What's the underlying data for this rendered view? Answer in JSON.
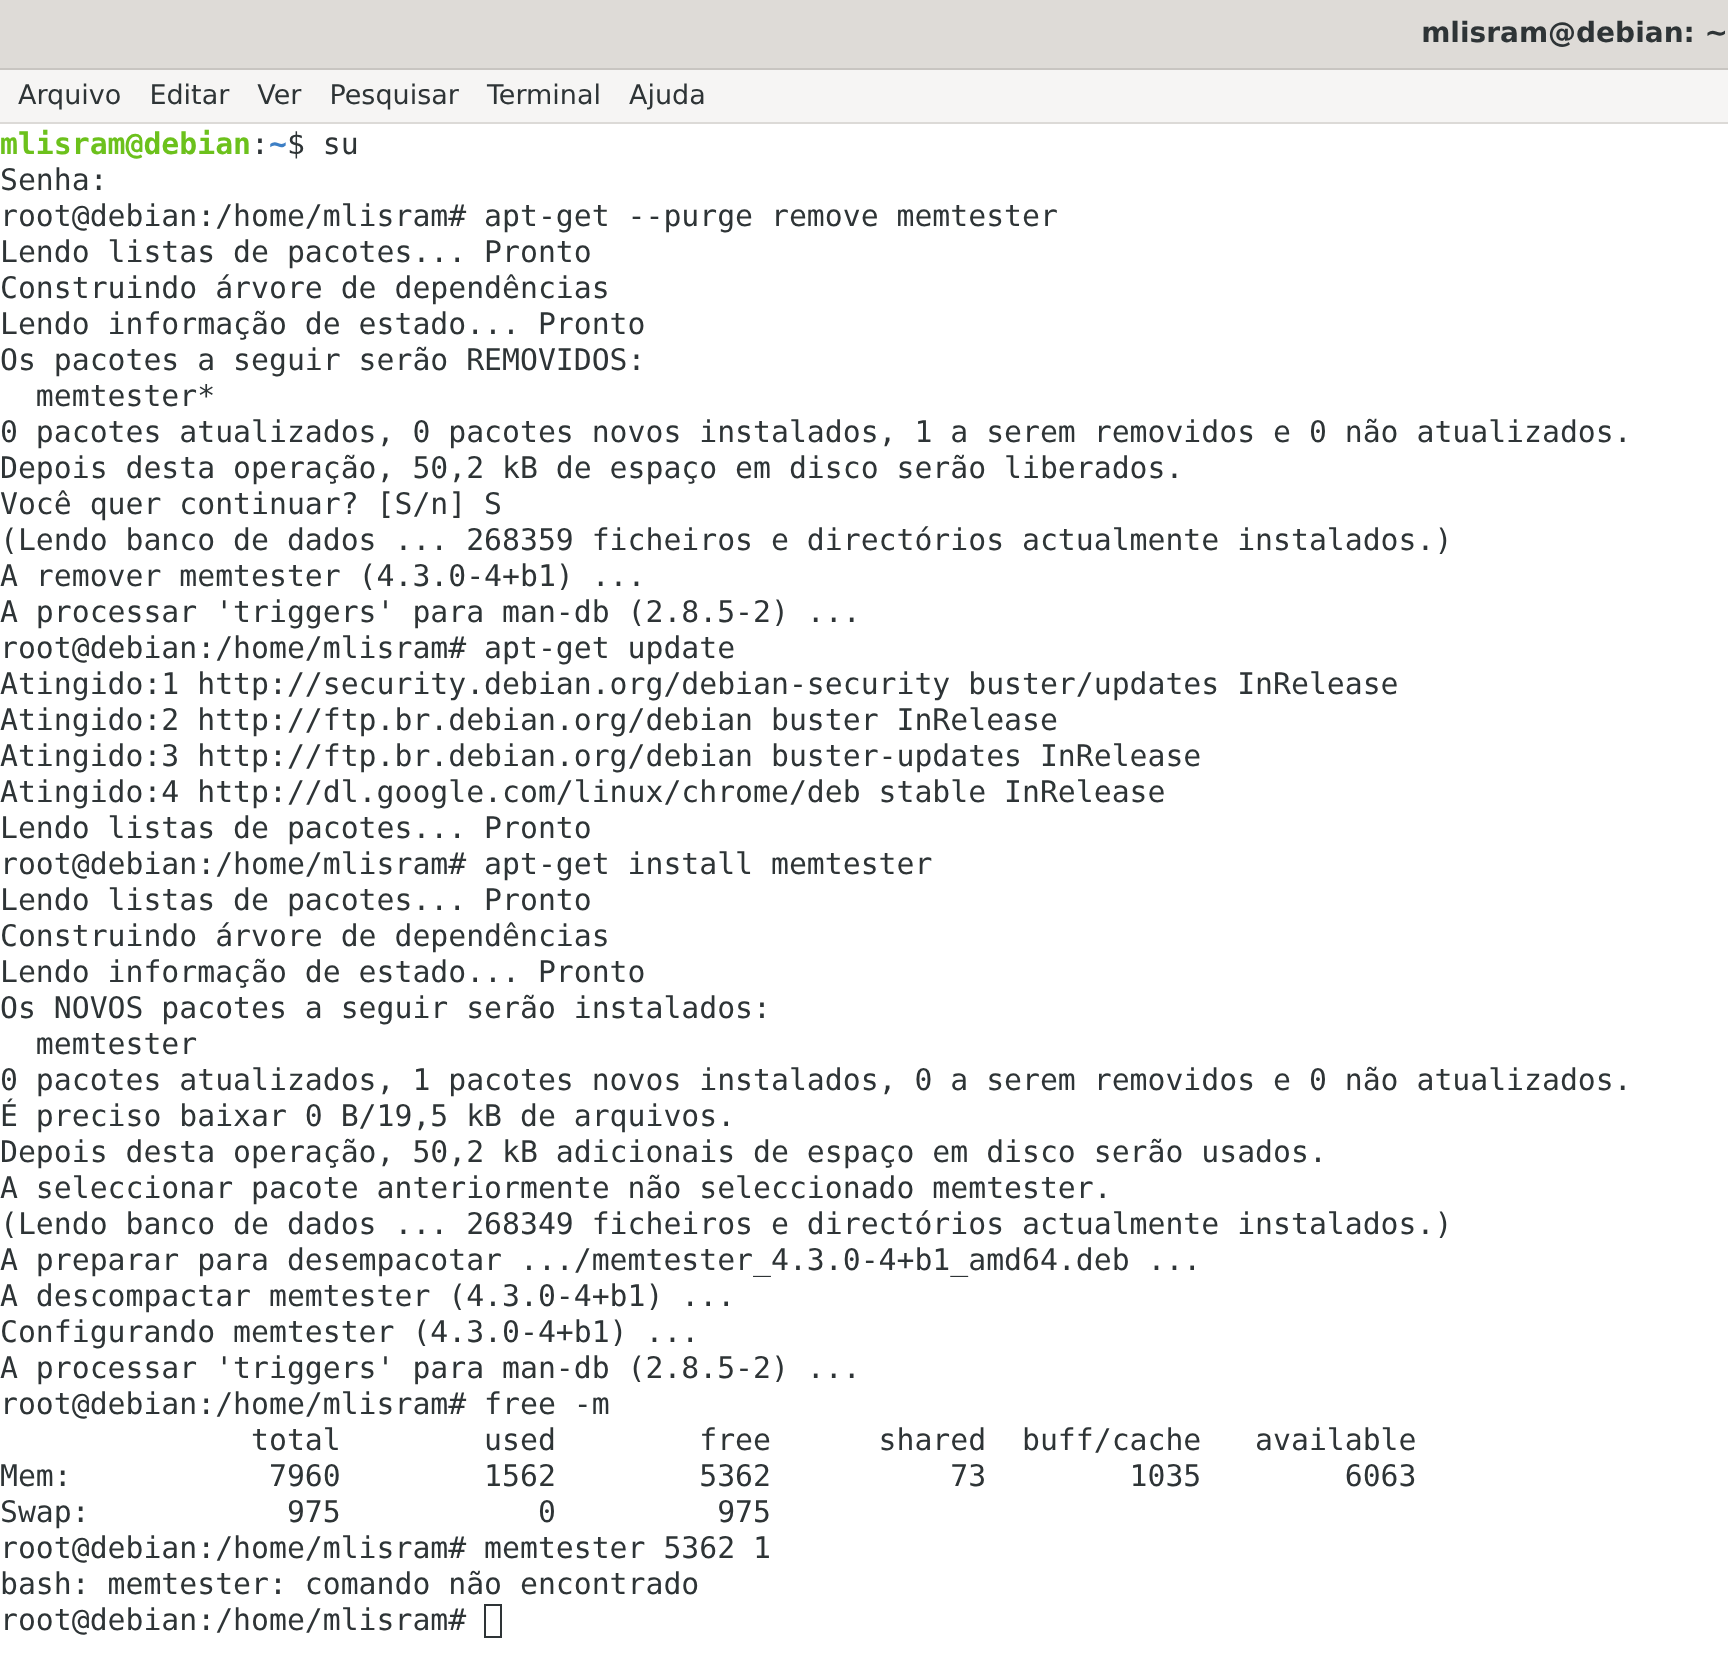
{
  "window": {
    "title": "mlisram@debian: ~"
  },
  "menu": [
    "Arquivo",
    "Editar",
    "Ver",
    "Pesquisar",
    "Terminal",
    "Ajuda"
  ],
  "terminal": {
    "lines": [
      {
        "kind": "prompt",
        "user_host": "mlisram@debian",
        "separator": ":",
        "path": "~",
        "rest": "$ su"
      },
      {
        "kind": "text",
        "text": "Senha:"
      },
      {
        "kind": "text",
        "text": "root@debian:/home/mlisram# apt-get --purge remove memtester"
      },
      {
        "kind": "text",
        "text": "Lendo listas de pacotes... Pronto"
      },
      {
        "kind": "text",
        "text": "Construindo árvore de dependências"
      },
      {
        "kind": "text",
        "text": "Lendo informação de estado... Pronto"
      },
      {
        "kind": "text",
        "text": "Os pacotes a seguir serão REMOVIDOS:"
      },
      {
        "kind": "text",
        "text": "  memtester*"
      },
      {
        "kind": "text",
        "text": "0 pacotes atualizados, 0 pacotes novos instalados, 1 a serem removidos e 0 não atualizados."
      },
      {
        "kind": "text",
        "text": "Depois desta operação, 50,2 kB de espaço em disco serão liberados."
      },
      {
        "kind": "text",
        "text": "Você quer continuar? [S/n] S"
      },
      {
        "kind": "text",
        "text": "(Lendo banco de dados ... 268359 ficheiros e directórios actualmente instalados.)"
      },
      {
        "kind": "text",
        "text": "A remover memtester (4.3.0-4+b1) ..."
      },
      {
        "kind": "text",
        "text": "A processar 'triggers' para man-db (2.8.5-2) ..."
      },
      {
        "kind": "text",
        "text": "root@debian:/home/mlisram# apt-get update"
      },
      {
        "kind": "text",
        "text": "Atingido:1 http://security.debian.org/debian-security buster/updates InRelease"
      },
      {
        "kind": "text",
        "text": "Atingido:2 http://ftp.br.debian.org/debian buster InRelease"
      },
      {
        "kind": "text",
        "text": "Atingido:3 http://ftp.br.debian.org/debian buster-updates InRelease"
      },
      {
        "kind": "text",
        "text": "Atingido:4 http://dl.google.com/linux/chrome/deb stable InRelease"
      },
      {
        "kind": "text",
        "text": "Lendo listas de pacotes... Pronto"
      },
      {
        "kind": "text",
        "text": "root@debian:/home/mlisram# apt-get install memtester"
      },
      {
        "kind": "text",
        "text": "Lendo listas de pacotes... Pronto"
      },
      {
        "kind": "text",
        "text": "Construindo árvore de dependências"
      },
      {
        "kind": "text",
        "text": "Lendo informação de estado... Pronto"
      },
      {
        "kind": "text",
        "text": "Os NOVOS pacotes a seguir serão instalados:"
      },
      {
        "kind": "text",
        "text": "  memtester"
      },
      {
        "kind": "text",
        "text": "0 pacotes atualizados, 1 pacotes novos instalados, 0 a serem removidos e 0 não atualizados."
      },
      {
        "kind": "text",
        "text": "É preciso baixar 0 B/19,5 kB de arquivos."
      },
      {
        "kind": "text",
        "text": "Depois desta operação, 50,2 kB adicionais de espaço em disco serão usados."
      },
      {
        "kind": "text",
        "text": "A seleccionar pacote anteriormente não seleccionado memtester."
      },
      {
        "kind": "text",
        "text": "(Lendo banco de dados ... 268349 ficheiros e directórios actualmente instalados.)"
      },
      {
        "kind": "text",
        "text": "A preparar para desempacotar .../memtester_4.3.0-4+b1_amd64.deb ..."
      },
      {
        "kind": "text",
        "text": "A descompactar memtester (4.3.0-4+b1) ..."
      },
      {
        "kind": "text",
        "text": "Configurando memtester (4.3.0-4+b1) ..."
      },
      {
        "kind": "text",
        "text": "A processar 'triggers' para man-db (2.8.5-2) ..."
      },
      {
        "kind": "text",
        "text": "root@debian:/home/mlisram# free -m"
      },
      {
        "kind": "text",
        "text": "              total        used        free      shared  buff/cache   available"
      },
      {
        "kind": "text",
        "text": "Mem:           7960        1562        5362          73        1035        6063"
      },
      {
        "kind": "text",
        "text": "Swap:           975           0         975"
      },
      {
        "kind": "text",
        "text": "root@debian:/home/mlisram# memtester 5362 1"
      },
      {
        "kind": "text",
        "text": "bash: memtester: comando não encontrado"
      },
      {
        "kind": "cursor",
        "text": "root@debian:/home/mlisram# "
      }
    ]
  }
}
